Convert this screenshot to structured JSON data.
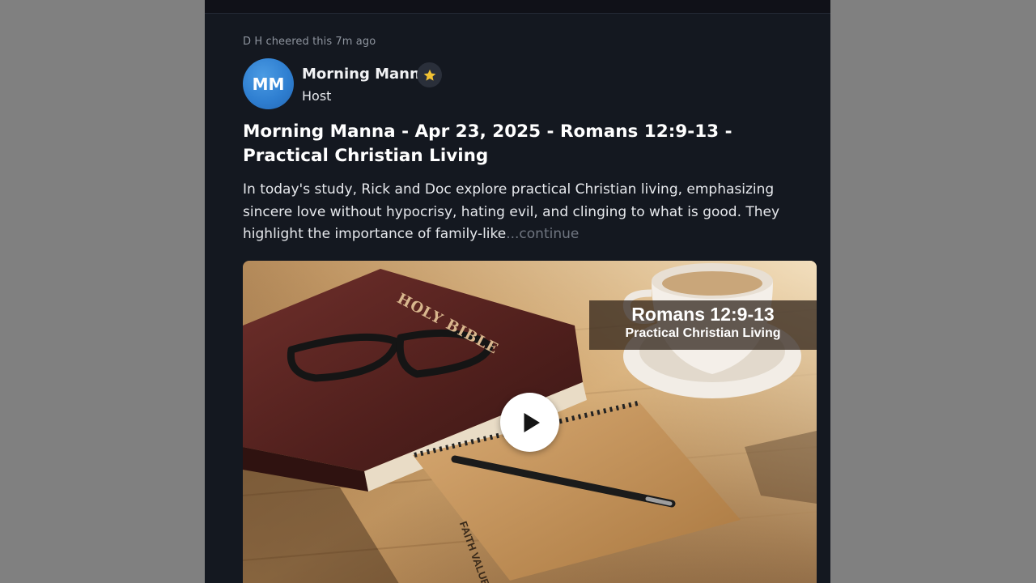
{
  "feed": {
    "activity_text": "D H cheered this 7m ago",
    "author": {
      "initials": "MM",
      "name": "Morning Manna",
      "badge_icon": "star-icon",
      "role": "Host"
    },
    "post": {
      "title": "Morning Manna - Apr 23, 2025 - Romans 12:9-13 - Practical Christian Living",
      "excerpt": "In today's study, Rick and Doc explore practical Christian living, emphasizing sincere love without hypocrisy, hating evil, and clinging to what is good. They highlight the importance of family-like",
      "continue_label": "...continue"
    },
    "video": {
      "banner_line1": "Romans 12:9-13",
      "banner_line2": "Practical Christian Living",
      "bible_cover_text": "HOLY BIBLE",
      "notebook_text": "FAITH VALUES",
      "play_icon": "play-icon"
    }
  },
  "colors": {
    "background": "#141820",
    "avatar": "#2f7fd1",
    "muted_text": "#8e949e",
    "badge_star": "#f2c233"
  }
}
